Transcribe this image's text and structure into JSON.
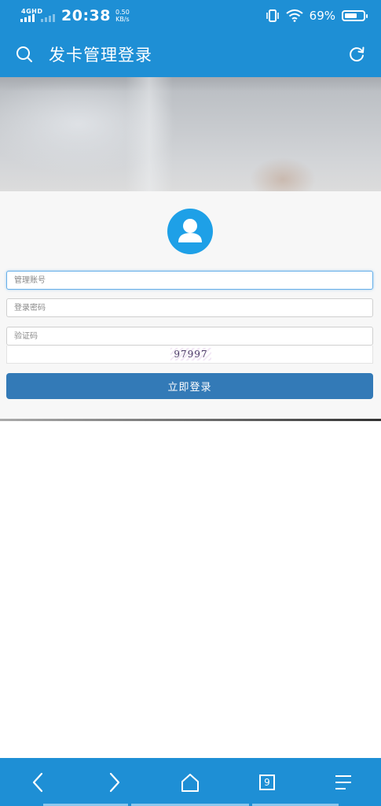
{
  "status_bar": {
    "network": "4GHD",
    "time": "20:38",
    "speed_value": "0.50",
    "speed_unit": "KB/s",
    "battery_pct": "69%",
    "battery_level": 0.69
  },
  "app_bar": {
    "title": "发卡管理登录",
    "left_icon": "search-icon",
    "right_icon": "refresh-icon"
  },
  "form": {
    "avatar_icon": "user-icon",
    "username": {
      "placeholder": "管理账号",
      "value": ""
    },
    "password": {
      "placeholder": "登录密码",
      "value": ""
    },
    "captcha_field": {
      "placeholder": "验证码",
      "value": ""
    },
    "captcha_text": "97997",
    "login_label": "立即登录"
  },
  "bottom_bar": {
    "items": [
      "back-icon",
      "forward-icon",
      "home-icon",
      "tabs-icon",
      "menu-icon"
    ],
    "tab_count": "9"
  },
  "colors": {
    "primary": "#1e8fd5",
    "button": "#337ab7",
    "avatar": "#1ea0e7"
  }
}
